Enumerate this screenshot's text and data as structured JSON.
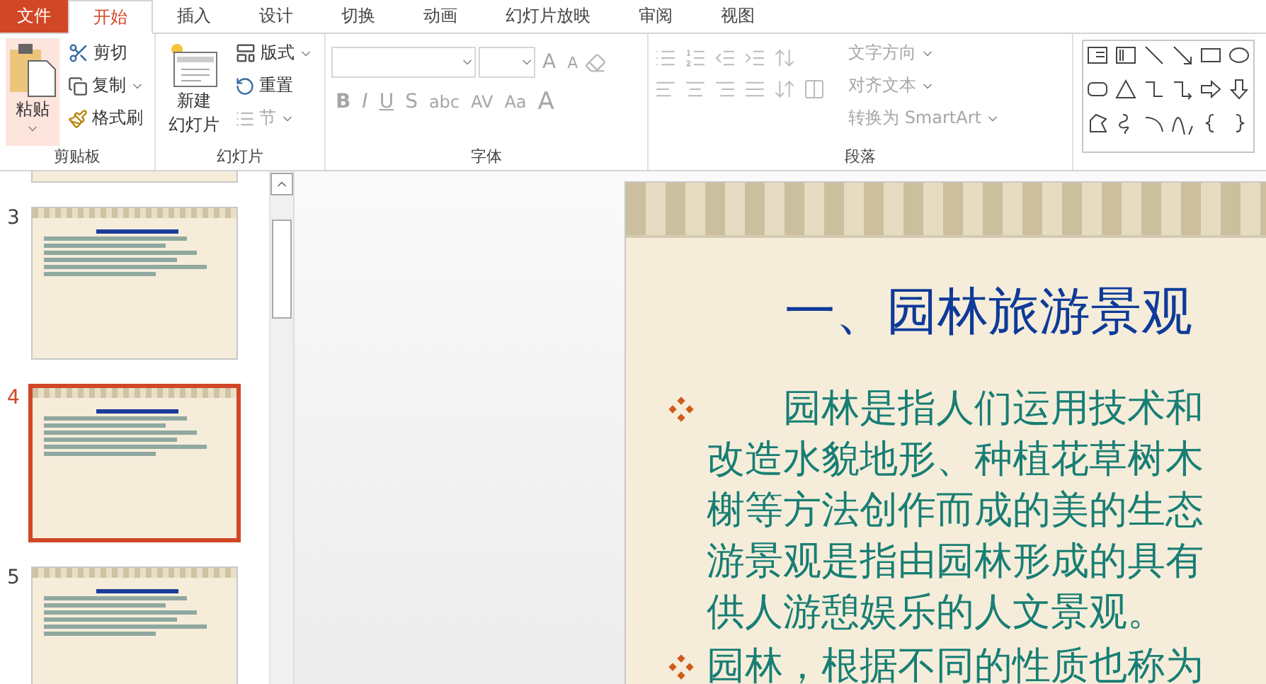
{
  "file_tab": "文件",
  "tabs": [
    {
      "label": "开始",
      "selected": true
    },
    {
      "label": "插入",
      "selected": false
    },
    {
      "label": "设计",
      "selected": false
    },
    {
      "label": "切换",
      "selected": false
    },
    {
      "label": "动画",
      "selected": false
    },
    {
      "label": "幻灯片放映",
      "selected": false
    },
    {
      "label": "审阅",
      "selected": false
    },
    {
      "label": "视图",
      "selected": false
    }
  ],
  "clipboard": {
    "paste": "粘贴",
    "cut": "剪切",
    "copy": "复制",
    "format_painter": "格式刷",
    "label": "剪贴板"
  },
  "slides_group": {
    "new_slide": [
      "新建",
      "幻灯片"
    ],
    "layout": "版式",
    "reset": "重置",
    "section": {
      "label": "节",
      "disabled": true
    },
    "label": "幻灯片"
  },
  "font": {
    "disabled": true,
    "grow": "A",
    "shrink": "A",
    "styles": [
      "B",
      "I",
      "U",
      "S",
      "abc",
      "AV",
      "Aa"
    ],
    "font_color_glyph": "A",
    "label": "字体"
  },
  "paragraph": {
    "disabled": true,
    "text_direction": "文字方向",
    "align_text": "对齐文本",
    "smartart": "转换为 SmartArt",
    "label": "段落"
  },
  "thumbnails": [
    {
      "selected": false
    },
    {
      "number": "3",
      "selected": false
    },
    {
      "number": "4",
      "selected": true
    },
    {
      "number": "5",
      "selected": false
    }
  ],
  "slide": {
    "title": "一、园林旅游景观",
    "bullets": [
      {
        "lines": [
          "　　园林是指人们运用技术和",
          "改造水貌地形、种植花草树木",
          "榭等方法创作而成的美的生态",
          "游景观是指由园林形成的具有",
          "供人游憩娱乐的人文景观。"
        ]
      },
      {
        "lines": [
          "园林，根据不同的性质也称为"
        ]
      }
    ]
  }
}
